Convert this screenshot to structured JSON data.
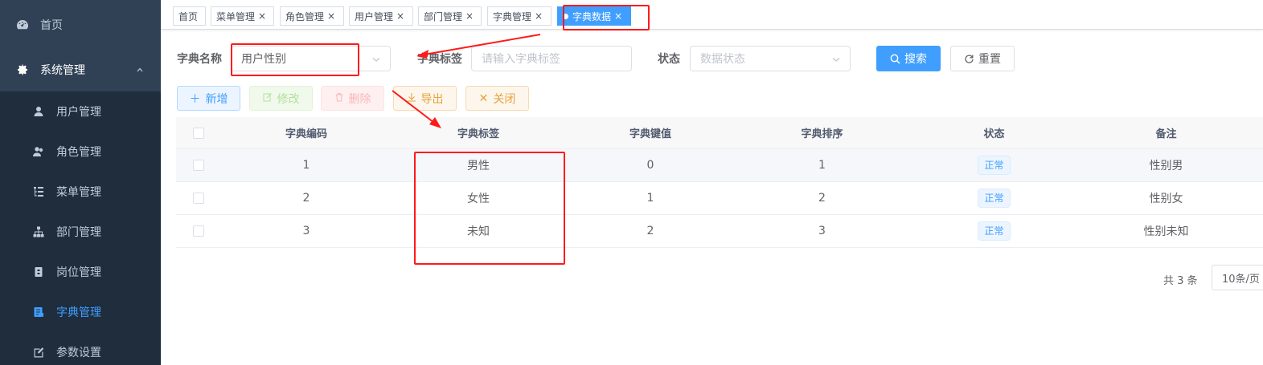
{
  "sidebar": {
    "home": "首页",
    "system": "系统管理",
    "items": [
      {
        "label": "用户管理"
      },
      {
        "label": "角色管理"
      },
      {
        "label": "菜单管理"
      },
      {
        "label": "部门管理"
      },
      {
        "label": "岗位管理"
      },
      {
        "label": "字典管理"
      },
      {
        "label": "参数设置"
      }
    ],
    "active_color": "#409eff"
  },
  "tags": [
    {
      "label": "首页"
    },
    {
      "label": "菜单管理"
    },
    {
      "label": "角色管理"
    },
    {
      "label": "用户管理"
    },
    {
      "label": "部门管理"
    },
    {
      "label": "字典管理"
    },
    {
      "label": "字典数据"
    }
  ],
  "form": {
    "dict_name_label": "字典名称",
    "dict_name_value": "用户性别",
    "dict_label_label": "字典标签",
    "dict_label_placeholder": "请输入字典标签",
    "status_label": "状态",
    "status_placeholder": "数据状态",
    "search_label": "搜索",
    "reset_label": "重置"
  },
  "toolbar": {
    "add_label": "新增",
    "edit_label": "修改",
    "delete_label": "删除",
    "export_label": "导出",
    "close_label": "关闭"
  },
  "table": {
    "columns": [
      "字典编码",
      "字典标签",
      "字典键值",
      "字典排序",
      "状态",
      "备注"
    ],
    "rows": [
      {
        "code": "1",
        "label": "男性",
        "value": "0",
        "sort": "1",
        "status": "正常",
        "remark": "性别男"
      },
      {
        "code": "2",
        "label": "女性",
        "value": "1",
        "sort": "2",
        "status": "正常",
        "remark": "性别女"
      },
      {
        "code": "3",
        "label": "未知",
        "value": "2",
        "sort": "3",
        "status": "正常",
        "remark": "性别未知"
      }
    ]
  },
  "pagination": {
    "total_text": "共 3 条",
    "page_size": "10条/页"
  },
  "annotation_color": "#ff1a1a"
}
